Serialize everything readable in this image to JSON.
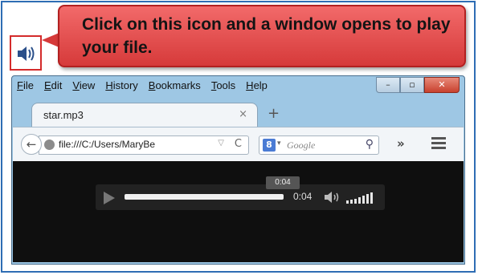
{
  "callout": {
    "text": "Click on this icon and a window opens to play your file."
  },
  "menubar": [
    "File",
    "Edit",
    "View",
    "History",
    "Bookmarks",
    "Tools",
    "Help"
  ],
  "window_controls": {
    "minimize": "–",
    "maximize": "▫",
    "close": "✕"
  },
  "tab": {
    "title": "star.mp3",
    "close": "×",
    "new_tab": "+"
  },
  "navbar": {
    "back": "←",
    "url": "file:///C:/Users/MaryBe",
    "url_dropdown": "▽",
    "reload": "C",
    "search_engine_letter": "8",
    "search_placeholder": "Google",
    "search_button": "⚲",
    "overflow": "»"
  },
  "player": {
    "current_time": "0:04",
    "tooltip_time": "0:04",
    "progress_fraction": 1.0,
    "volume_level": 1.0
  },
  "colors": {
    "accent": "#d63a3a",
    "frame": "#2e6db4",
    "window_chrome": "#9ec7e4"
  }
}
